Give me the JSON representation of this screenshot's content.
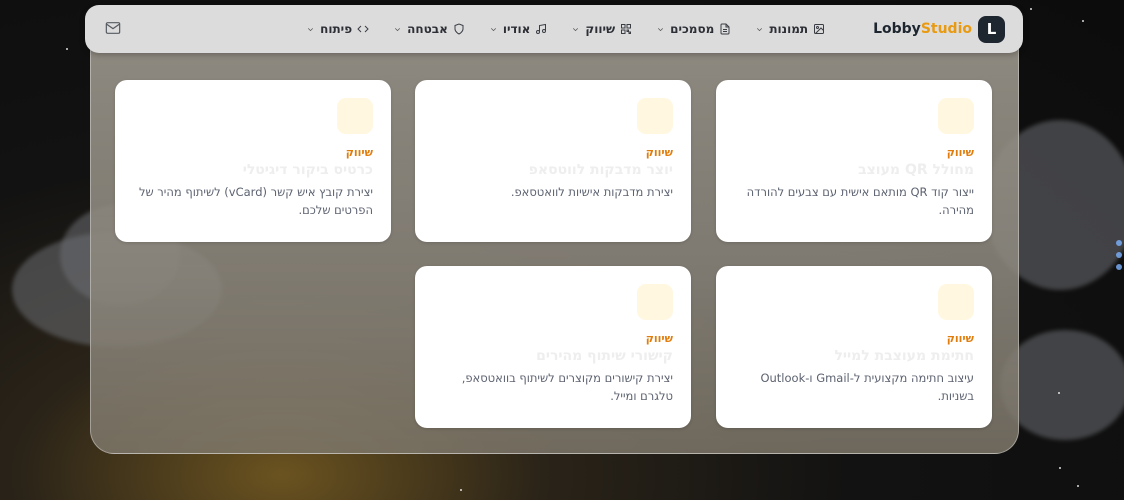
{
  "brand": {
    "badge": "L",
    "name_a": "Lobby",
    "name_b": "Studio"
  },
  "nav": {
    "items": [
      {
        "label": "תמונות"
      },
      {
        "label": "מסמכים"
      },
      {
        "label": "שיווק"
      },
      {
        "label": "אודיו"
      },
      {
        "label": "אבטחה"
      },
      {
        "label": "פיתוח"
      }
    ]
  },
  "cards": [
    {
      "tag": "שיווק",
      "title": "מחולל QR מעוצב",
      "desc": "ייצור קוד QR מותאם אישית עם צבעים להורדה מהירה."
    },
    {
      "tag": "שיווק",
      "title": "יוצר מדבקות לווטסאפ",
      "desc": "יצירת מדבקות אישיות לוואטסאפ."
    },
    {
      "tag": "שיווק",
      "title": "כרטיס ביקור דיגיטלי",
      "desc": "יצירת קובץ איש קשר (vCard) לשיתוף מהיר של הפרטים שלכם."
    },
    {
      "tag": "שיווק",
      "title": "חתימת מעוצבת למייל",
      "desc": "עיצוב חתימה מקצועית ל-Gmail ו-Outlook בשניות."
    },
    {
      "tag": "שיווק",
      "title": "קישורי שיתוף מהירים",
      "desc": "יצירת קישורים מקוצרים לשיתוף בוואטסאפ, טלגרם ומייל."
    }
  ]
}
